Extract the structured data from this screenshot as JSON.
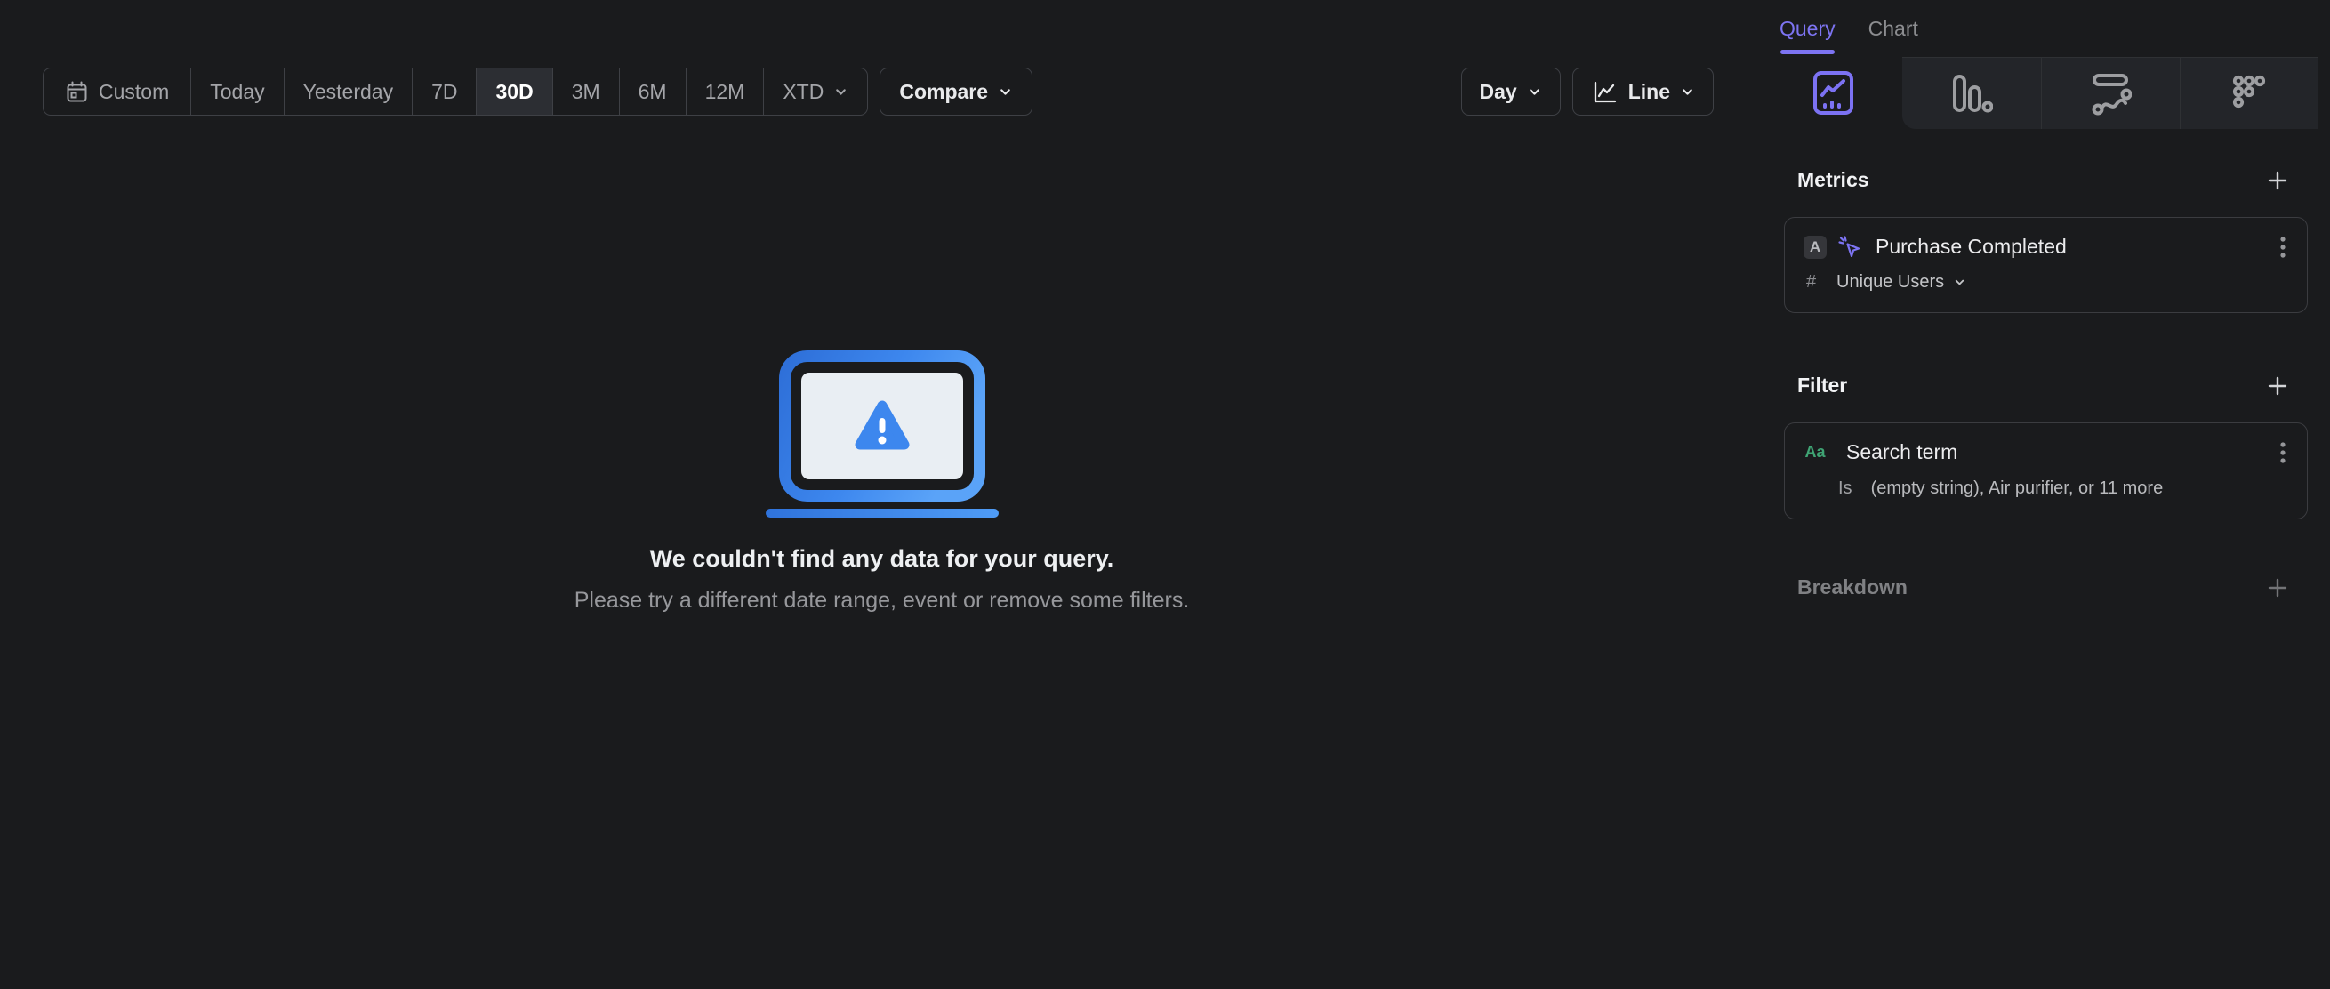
{
  "toolbar": {
    "date_ranges": [
      {
        "label": "Custom",
        "selected": false
      },
      {
        "label": "Today",
        "selected": false
      },
      {
        "label": "Yesterday",
        "selected": false
      },
      {
        "label": "7D",
        "selected": false
      },
      {
        "label": "30D",
        "selected": true
      },
      {
        "label": "3M",
        "selected": false
      },
      {
        "label": "6M",
        "selected": false
      },
      {
        "label": "12M",
        "selected": false
      },
      {
        "label": "XTD",
        "selected": false
      }
    ],
    "compare_label": "Compare",
    "granularity_label": "Day",
    "chart_type_label": "Line"
  },
  "empty_state": {
    "title": "We couldn't find any data for your query.",
    "subtitle": "Please try a different date range, event or remove some filters."
  },
  "sidebar": {
    "tabs": [
      {
        "label": "Query",
        "active": true
      },
      {
        "label": "Chart",
        "active": false
      }
    ],
    "view_tabs": [
      {
        "name": "insights-line",
        "active": true
      },
      {
        "name": "bar-chart",
        "active": false
      },
      {
        "name": "flows",
        "active": false
      },
      {
        "name": "grid-dots",
        "active": false
      }
    ],
    "metrics": {
      "header": "Metrics",
      "item": {
        "letter": "A",
        "event": "Purchase Completed",
        "aggregation_symbol": "#",
        "aggregation": "Unique Users"
      }
    },
    "filter": {
      "header": "Filter",
      "item": {
        "type_label": "Aa",
        "property": "Search term",
        "operator": "Is",
        "values": "(empty string), Air purifier, or 11 more"
      }
    },
    "breakdown": {
      "header": "Breakdown"
    }
  },
  "colors": {
    "accent_purple": "#7d74f2",
    "accent_green": "#3fa474",
    "accent_blue": "#3d87ee",
    "selected_button_bg": "#2c2e33",
    "background": "#1a1b1d"
  }
}
